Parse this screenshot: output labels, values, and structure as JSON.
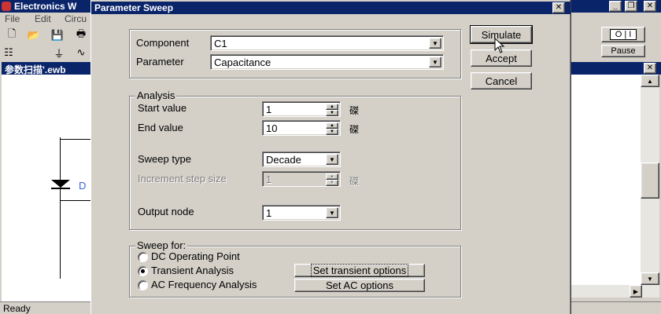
{
  "app": {
    "title": "Electronics W",
    "menu": [
      "File",
      "Edit",
      "Circu"
    ],
    "doc_title": "参数扫描'.ewb",
    "pause_label": "Pause",
    "power_label": "O | I",
    "status": "Ready"
  },
  "circuit": {
    "label": "D"
  },
  "dialog": {
    "title": "Parameter Sweep",
    "close_glyph": "✕",
    "component_label": "Component",
    "component_value": "C1",
    "parameter_label": "Parameter",
    "parameter_value": "Capacitance",
    "buttons": {
      "simulate": "Simulate",
      "accept": "Accept",
      "cancel": "Cancel"
    },
    "analysis": {
      "legend": "Analysis",
      "start_label": "Start value",
      "start_value": "1",
      "end_label": "End value",
      "end_value": "10",
      "unit": "磔",
      "sweep_type_label": "Sweep type",
      "sweep_type_value": "Decade",
      "increment_label": "Increment step size",
      "increment_value": "1",
      "output_label": "Output node",
      "output_value": "1"
    },
    "sweep_for": {
      "legend": "Sweep for:",
      "options": [
        "DC Operating Point",
        "Transient Analysis",
        "AC Frequency Analysis"
      ],
      "selected": "Transient Analysis",
      "transient_button": "Set transient options",
      "ac_button": "Set AC options"
    }
  }
}
